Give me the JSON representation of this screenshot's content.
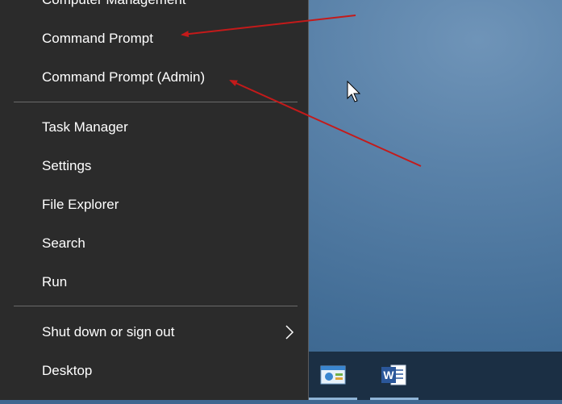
{
  "power_menu": {
    "items": [
      {
        "label": "Computer Management",
        "name": "menu-item-computer-management"
      },
      {
        "label": "Command Prompt",
        "name": "menu-item-command-prompt"
      },
      {
        "label": "Command Prompt (Admin)",
        "name": "menu-item-command-prompt-admin"
      },
      {
        "label": "Task Manager",
        "name": "menu-item-task-manager"
      },
      {
        "label": "Settings",
        "name": "menu-item-settings"
      },
      {
        "label": "File Explorer",
        "name": "menu-item-file-explorer"
      },
      {
        "label": "Search",
        "name": "menu-item-search"
      },
      {
        "label": "Run",
        "name": "menu-item-run"
      },
      {
        "label": "Shut down or sign out",
        "name": "menu-item-shut-down-or-sign-out"
      },
      {
        "label": "Desktop",
        "name": "menu-item-desktop"
      }
    ]
  },
  "taskbar": {
    "apps": [
      {
        "icon": "control-panel-icon"
      },
      {
        "icon": "word-icon",
        "glyph": "W"
      }
    ]
  },
  "annotations": {
    "arrow_color": "#c41a1a"
  },
  "colors": {
    "menu_bg": "#2b2b2b",
    "desktop_accent": "#4a77a3",
    "taskbar_bg": "#1b2f44"
  }
}
